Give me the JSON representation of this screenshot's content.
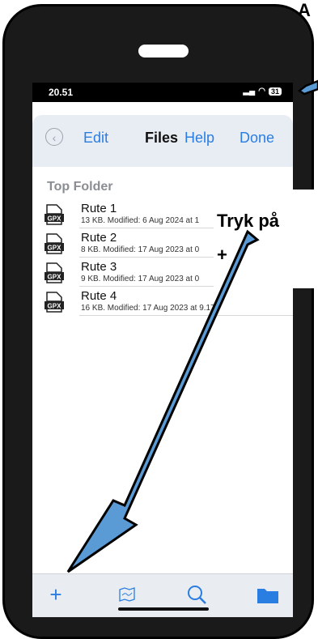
{
  "annotation": {
    "top_text": "A",
    "instruction_line1": "Tryk på",
    "instruction_line2": "+"
  },
  "status_bar": {
    "time": "20.51",
    "battery": "31"
  },
  "nav": {
    "back_icon": "chevron-left-icon",
    "edit_label": "Edit",
    "title": "Files",
    "help_label": "Help",
    "done_label": "Done"
  },
  "folder": {
    "title": "Top Folder",
    "files": [
      {
        "name": "Rute 1",
        "meta": "13 KB. Modified: 6 Aug 2024 at 1"
      },
      {
        "name": "Rute 2",
        "meta": "8 KB. Modified: 17 Aug 2023 at 0"
      },
      {
        "name": "Rute 3",
        "meta": "9 KB. Modified: 17 Aug 2023 at 0"
      },
      {
        "name": "Rute 4",
        "meta": "16 KB. Modified: 17 Aug 2023 at 9.17"
      }
    ]
  },
  "tabbar": {
    "items": [
      "add-icon",
      "map-icon",
      "search-icon",
      "folder-icon"
    ],
    "accent": "#2a7de1"
  },
  "colors": {
    "arrow_fill": "#5b9bd5",
    "nav_bg": "#e8edf3"
  }
}
